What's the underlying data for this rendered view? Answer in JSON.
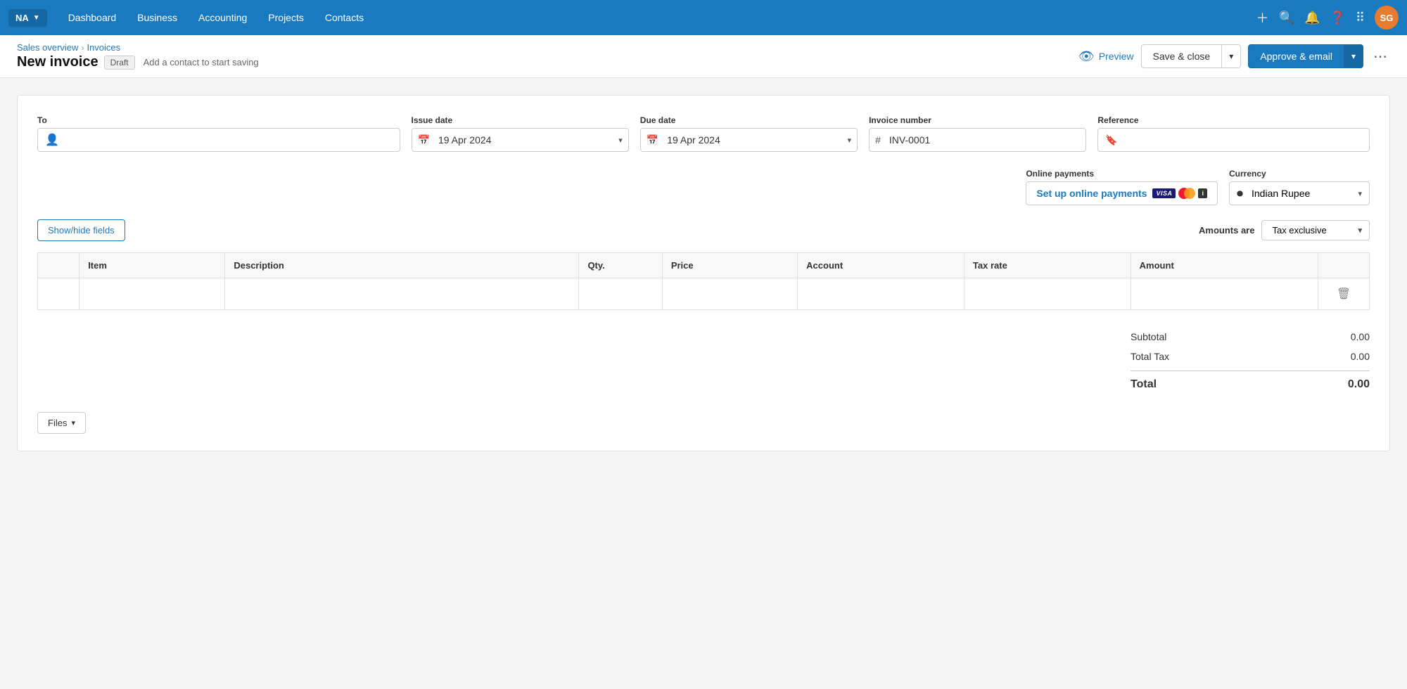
{
  "navbar": {
    "org": "NA",
    "links": [
      "Dashboard",
      "Business",
      "Accounting",
      "Projects",
      "Contacts"
    ],
    "avatar_initials": "SG"
  },
  "breadcrumb": {
    "parent": "Sales overview",
    "separator": "›",
    "current": "Invoices"
  },
  "header": {
    "title": "New invoice",
    "badge": "Draft",
    "subtitle": "Add a contact to start saving",
    "preview_label": "Preview",
    "save_close_label": "Save & close",
    "approve_email_label": "Approve & email"
  },
  "form": {
    "to_label": "To",
    "to_placeholder": "",
    "issue_date_label": "Issue date",
    "issue_date_value": "19 Apr 2024",
    "due_date_label": "Due date",
    "due_date_value": "19 Apr 2024",
    "invoice_number_label": "Invoice number",
    "invoice_number_value": "INV-0001",
    "reference_label": "Reference",
    "reference_value": "",
    "online_payments_label": "Online payments",
    "setup_payments_label": "Set up online payments",
    "currency_label": "Currency",
    "currency_value": "Indian Rupee",
    "amounts_are_label": "Amounts are",
    "amounts_are_value": "Tax exclusive",
    "show_hide_label": "Show/hide fields"
  },
  "table": {
    "columns": [
      "",
      "Item",
      "Description",
      "Qty.",
      "Price",
      "Account",
      "Tax rate",
      "Amount",
      ""
    ],
    "rows": []
  },
  "totals": {
    "subtotal_label": "Subtotal",
    "subtotal_value": "0.00",
    "total_tax_label": "Total Tax",
    "total_tax_value": "0.00",
    "total_label": "Total",
    "total_value": "0.00"
  },
  "footer": {
    "files_label": "Files"
  }
}
